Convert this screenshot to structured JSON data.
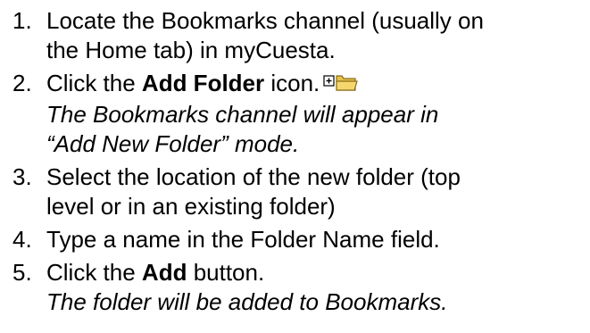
{
  "steps": [
    {
      "number": "1.",
      "line1": "Locate the Bookmarks channel (usually on",
      "line2": "the Home tab) in myCuesta."
    },
    {
      "number": "2.",
      "pre": "Click the ",
      "bold": "Add Folder",
      "post": " icon.",
      "icon": "add-folder-icon",
      "note1": "The Bookmarks channel will appear in",
      "note2": "“Add New Folder” mode."
    },
    {
      "number": "3.",
      "line1": "Select the location of the new folder (top",
      "line2": "level or in an existing folder)"
    },
    {
      "number": "4.",
      "line1": "Type a name in the Folder Name field."
    },
    {
      "number": "5.",
      "pre": "Click the ",
      "bold": "Add",
      "post": " button.",
      "note1": "The folder will be added to Bookmarks."
    }
  ],
  "colors": {
    "text": "#000000",
    "folder_fill": "#f5d76e",
    "folder_stroke": "#8a6d1c"
  }
}
